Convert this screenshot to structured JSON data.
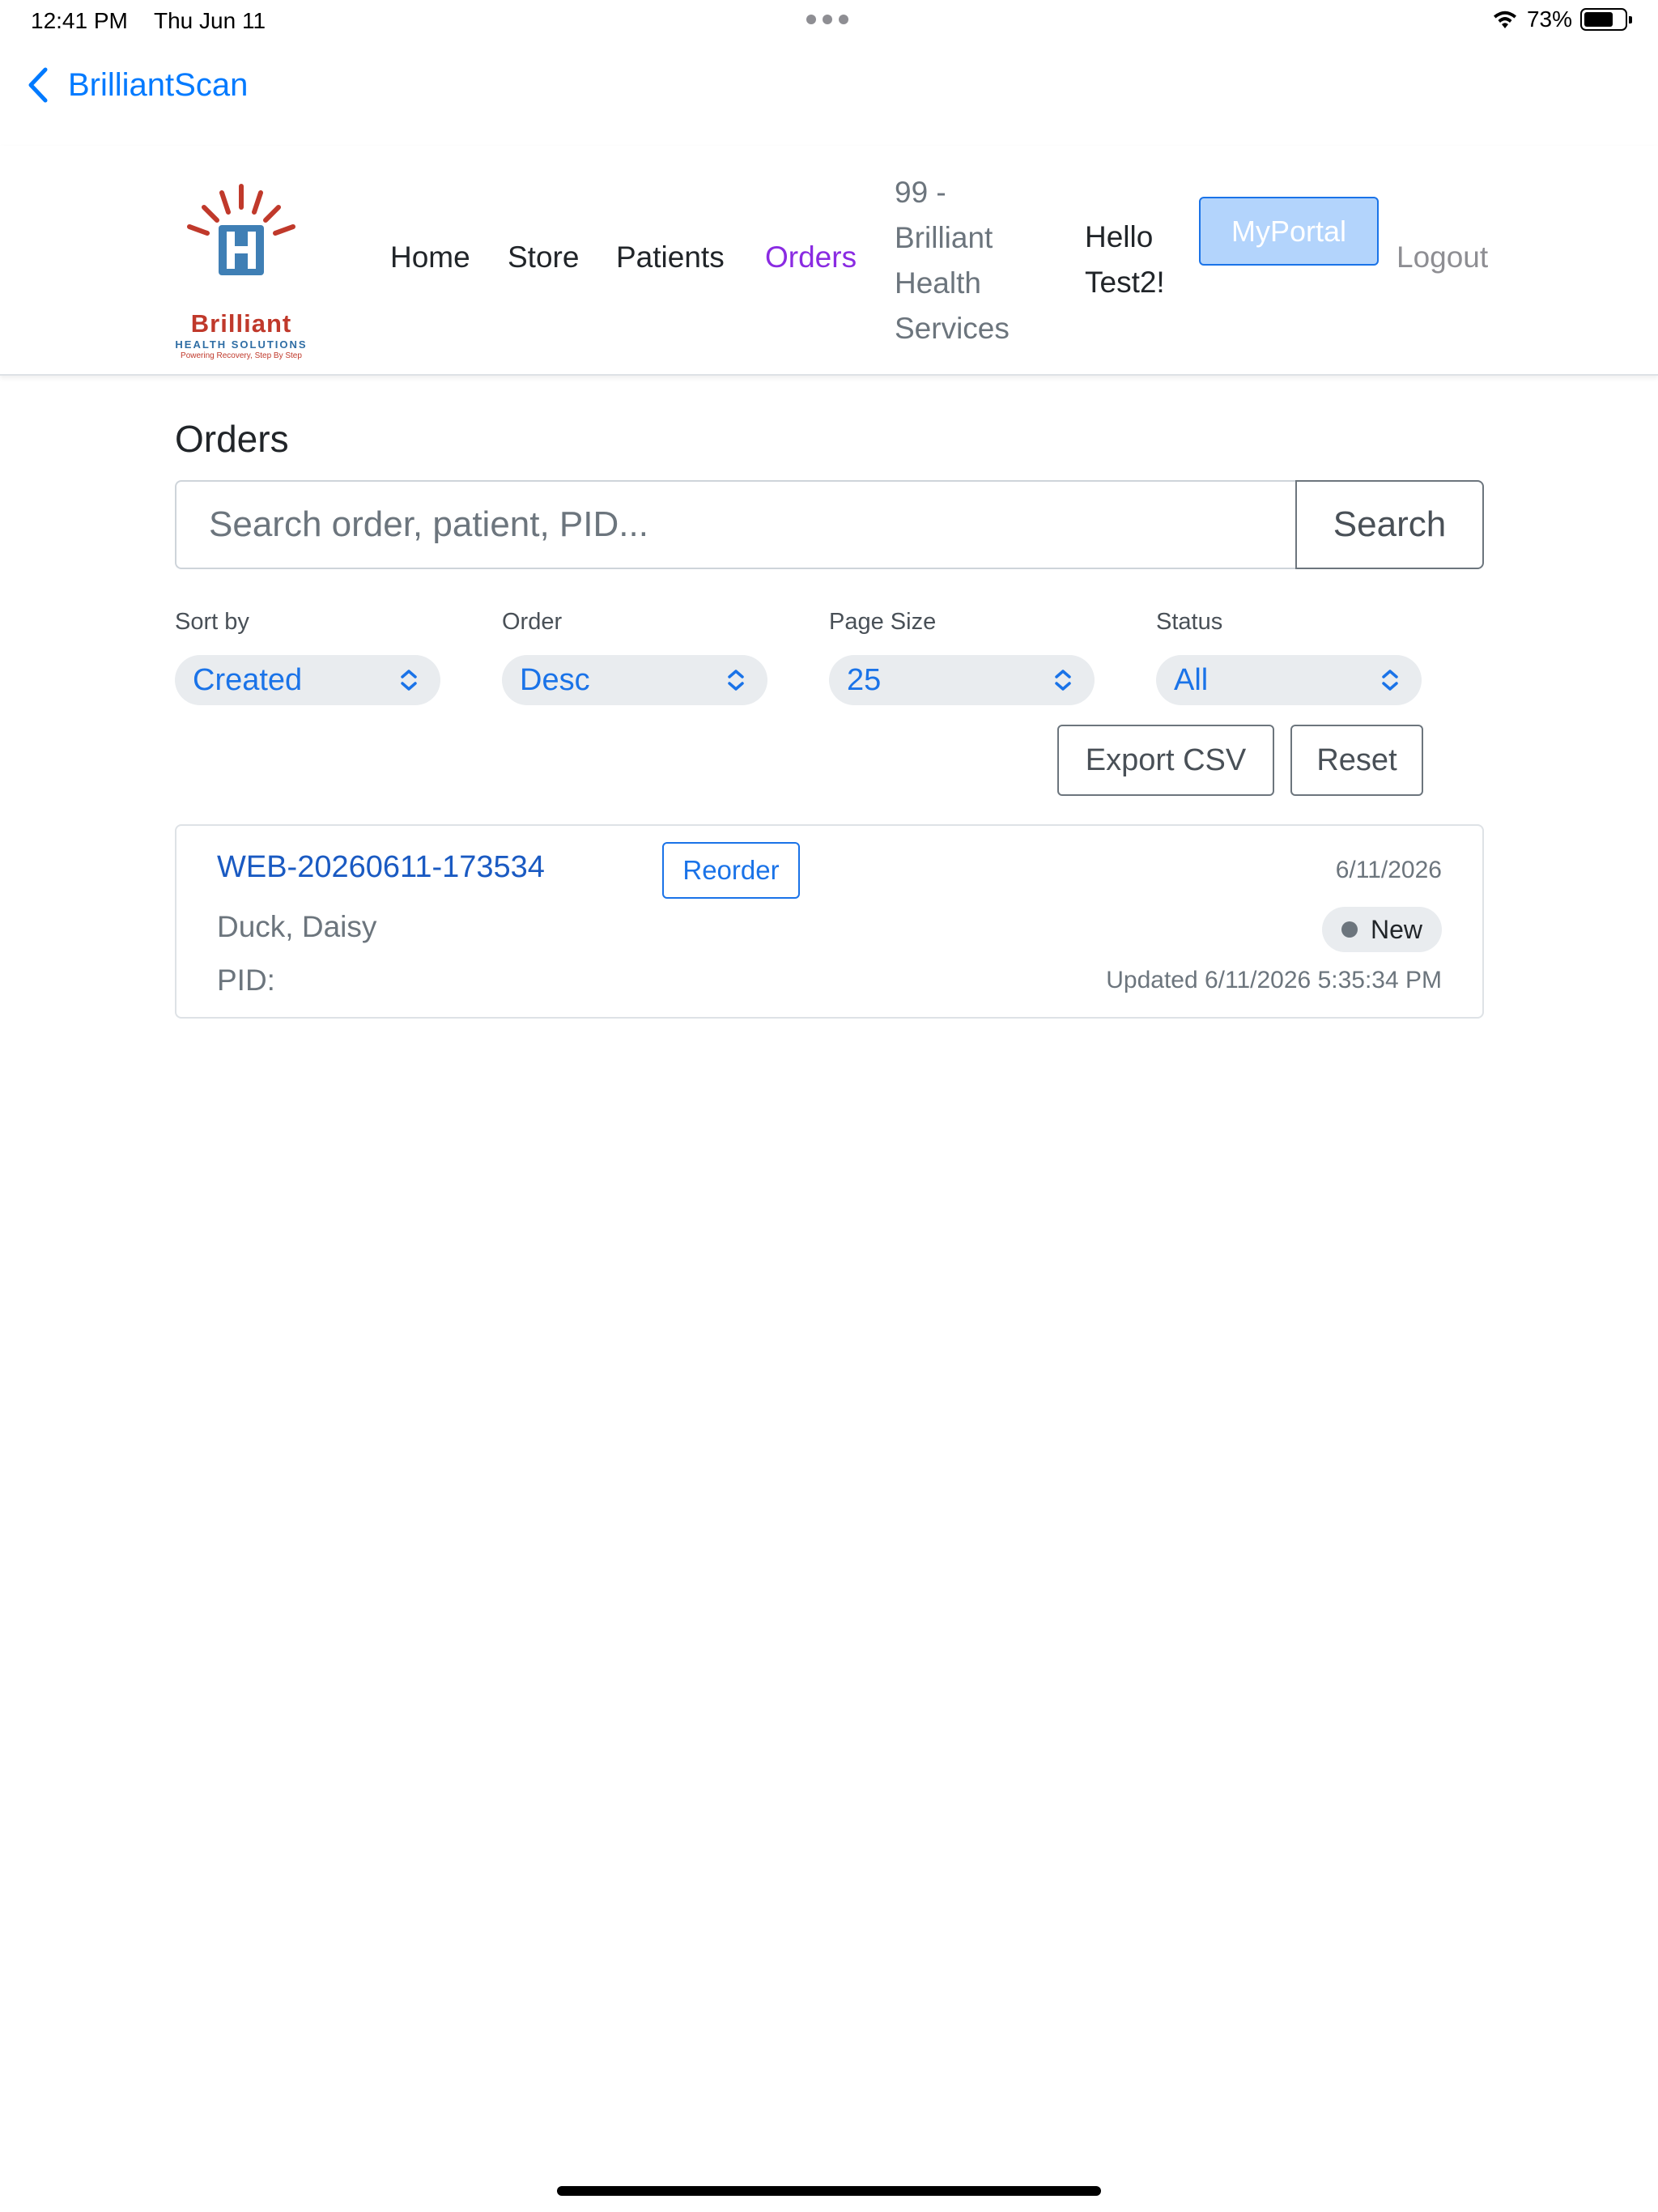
{
  "status_bar": {
    "time": "12:41 PM",
    "date": "Thu Jun 11",
    "battery_percent": "73%",
    "battery_level": 0.73,
    "icons": [
      "wifi-icon",
      "battery-icon"
    ]
  },
  "back_nav": {
    "label": "BrilliantScan",
    "icon": "chevron-left-icon"
  },
  "header": {
    "logo": {
      "word": "Brilliant",
      "sub": "HEALTH SOLUTIONS",
      "tagline": "Powering Recovery, Step By Step"
    },
    "nav": {
      "home": "Home",
      "store": "Store",
      "patients": "Patients",
      "orders": "Orders",
      "org": "99 - Brilliant Health Services",
      "hello": "Hello Test2!",
      "portal": "MyPortal",
      "logout": "Logout"
    }
  },
  "orders_page": {
    "title": "Orders",
    "search": {
      "placeholder": "Search order, patient, PID...",
      "value": "",
      "button_label": "Search"
    },
    "filters": {
      "sort_by": {
        "label": "Sort by",
        "value": "Created"
      },
      "order": {
        "label": "Order",
        "value": "Desc"
      },
      "page_size": {
        "label": "Page Size",
        "value": "25"
      },
      "status": {
        "label": "Status",
        "value": "All"
      }
    },
    "actions": {
      "export_csv": "Export CSV",
      "reset": "Reset"
    },
    "orders": [
      {
        "id": "WEB-20260611-173534",
        "reorder_label": "Reorder",
        "date": "6/11/2026",
        "patient": "Duck, Daisy",
        "status": "New",
        "pid": "PID:",
        "updated": "Updated 6/11/2026 5:35:34 PM"
      }
    ]
  },
  "colors": {
    "accent": "#1a73e8",
    "active_nav": "#8a2be2",
    "ios_blue": "#007aff",
    "muted": "#6c757d",
    "portal_bg": "#b3d4fc"
  }
}
